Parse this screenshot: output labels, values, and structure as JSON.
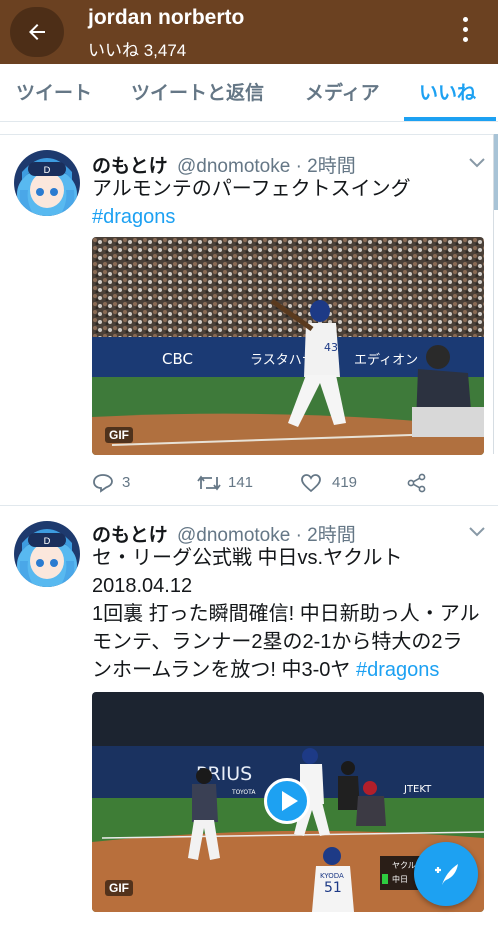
{
  "header": {
    "title": "jordan norberto",
    "subtitle": "いいね 3,474",
    "back_icon": "arrow-left-icon",
    "more_icon": "more-vertical-icon",
    "background": "#6b4121"
  },
  "tabs": [
    {
      "label": "ツイート",
      "active": false
    },
    {
      "label": "ツイートと返信",
      "active": false
    },
    {
      "label": "メディア",
      "active": false
    },
    {
      "label": "いいね",
      "active": true
    }
  ],
  "accent": "#1da1f2",
  "tweets": [
    {
      "name": "のもとけ",
      "handle": "@dnomotoke · 2時間",
      "lines": [
        "アルモンテのパーフェクトスイング"
      ],
      "hashtag": "#dragons",
      "media_badge": "GIF",
      "banner_texts": [
        "CBC",
        "ラスタハナ",
        "エディオン"
      ],
      "uniform_number": "43",
      "reply_count": "3",
      "retweet_count": "141",
      "like_count": "419"
    },
    {
      "name": "のもとけ",
      "handle": "@dnomotoke · 2時間",
      "lines": [
        "セ・リーグ公式戦 中日vs.ヤクルト",
        "2018.04.12",
        "1回裏 打った瞬間確信! 中日新助っ人・アル",
        "モンテ、ランナー2塁の2-1から特大の2ラ"
      ],
      "last_line": "ンホームランを放つ! 中3-0ヤ",
      "hashtag": "#dragons",
      "media_badge": "GIF",
      "banner_texts": [
        "PRIUS",
        "TOYOTA",
        "JTEKT"
      ],
      "scoreboard": [
        "ヤクルト",
        "中日"
      ],
      "player_name": "KYODA",
      "uniform_number": "51"
    }
  ]
}
